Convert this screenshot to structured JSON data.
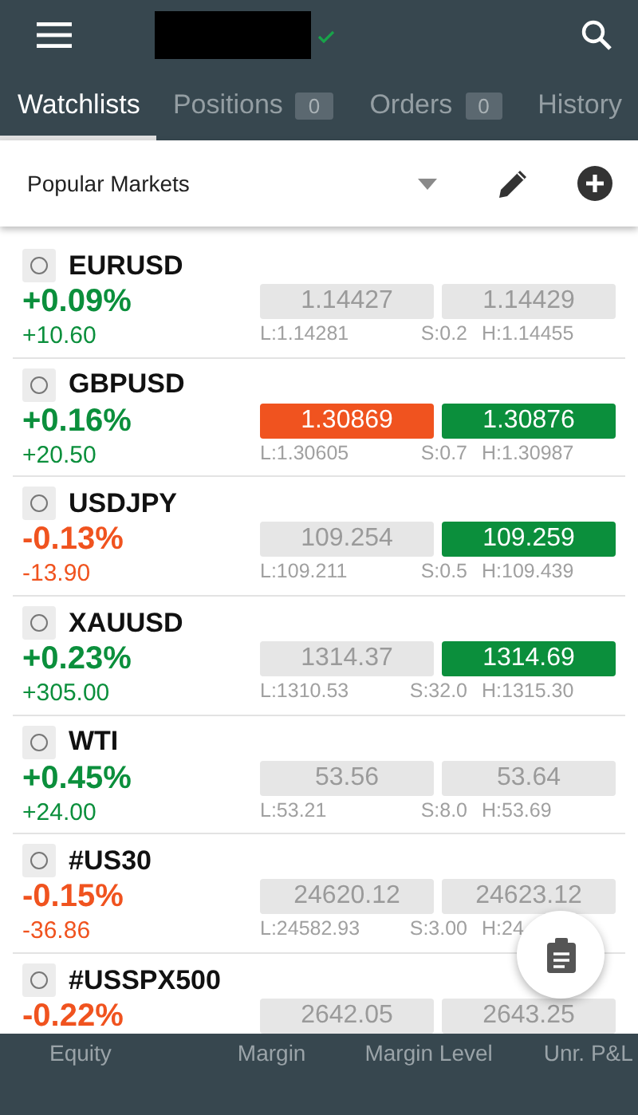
{
  "tabs": [
    {
      "label": "Watchlists",
      "selected": true
    },
    {
      "label": "Positions",
      "badge": "0",
      "selected": false
    },
    {
      "label": "Orders",
      "badge": "0",
      "selected": false
    },
    {
      "label": "History",
      "selected": false
    }
  ],
  "watchlist": {
    "name": "Popular Markets"
  },
  "markets": [
    {
      "symbol": "EURUSD",
      "selected": false,
      "percent": "+0.09%",
      "change": "+10.60",
      "negative": false,
      "bid": {
        "price": "1.14427",
        "highlighted": false
      },
      "ask": {
        "price": "1.14429",
        "highlighted": false
      },
      "low": "L:1.14281",
      "spread": "S:0.2",
      "high": "H:1.14455"
    },
    {
      "symbol": "GBPUSD",
      "selected": false,
      "percent": "+0.16%",
      "change": "+20.50",
      "negative": false,
      "bid": {
        "price": "1.30869",
        "highlighted": true
      },
      "ask": {
        "price": "1.30876",
        "highlighted": true
      },
      "low": "L:1.30605",
      "spread": "S:0.7",
      "high": "H:1.30987"
    },
    {
      "symbol": "USDJPY",
      "selected": false,
      "percent": "-0.13%",
      "change": "-13.90",
      "negative": true,
      "bid": {
        "price": "109.254",
        "highlighted": false
      },
      "ask": {
        "price": "109.259",
        "highlighted": true
      },
      "low": "L:109.211",
      "spread": "S:0.5",
      "high": "H:109.439"
    },
    {
      "symbol": "XAUUSD",
      "selected": false,
      "percent": "+0.23%",
      "change": "+305.00",
      "negative": false,
      "bid": {
        "price": "1314.37",
        "highlighted": false
      },
      "ask": {
        "price": "1314.69",
        "highlighted": true
      },
      "low": "L:1310.53",
      "spread": "S:32.0",
      "high": "H:1315.30"
    },
    {
      "symbol": "WTI",
      "selected": false,
      "percent": "+0.45%",
      "change": "+24.00",
      "negative": false,
      "bid": {
        "price": "53.56",
        "highlighted": false
      },
      "ask": {
        "price": "53.64",
        "highlighted": false
      },
      "low": "L:53.21",
      "spread": "S:8.0",
      "high": "H:53.69"
    },
    {
      "symbol": "#US30",
      "selected": false,
      "percent": "-0.15%",
      "change": "-36.86",
      "negative": true,
      "bid": {
        "price": "24620.12",
        "highlighted": false
      },
      "ask": {
        "price": "24623.12",
        "highlighted": false
      },
      "low": "L:24582.93",
      "spread": "S:3.00",
      "high": "H:24"
    },
    {
      "symbol": "#USSPX500",
      "selected": false,
      "percent": "-0.22%",
      "negative": true,
      "bid": {
        "price": "2642.05",
        "highlighted": false
      },
      "ask": {
        "price": "2643.25",
        "highlighted": false
      }
    }
  ],
  "footer": [
    "Equity",
    "Margin",
    "Margin Level",
    "Unr. P&L"
  ]
}
